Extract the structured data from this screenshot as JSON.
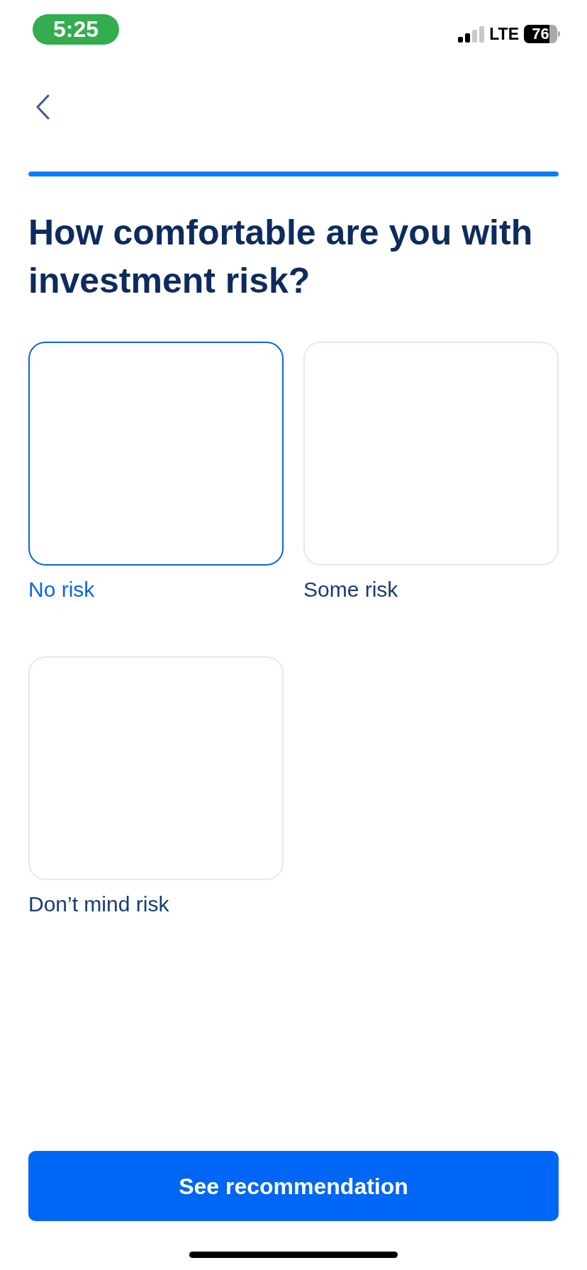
{
  "status_bar": {
    "time": "5:25",
    "network": "LTE",
    "battery": "76"
  },
  "progress": {
    "level": 1
  },
  "question": "How comfortable are you with investment risk?",
  "options": [
    {
      "label": "No risk",
      "selected": true
    },
    {
      "label": "Some risk",
      "selected": false
    },
    {
      "label": "Don’t mind risk",
      "selected": false
    }
  ],
  "primary_button": "See recommendation"
}
